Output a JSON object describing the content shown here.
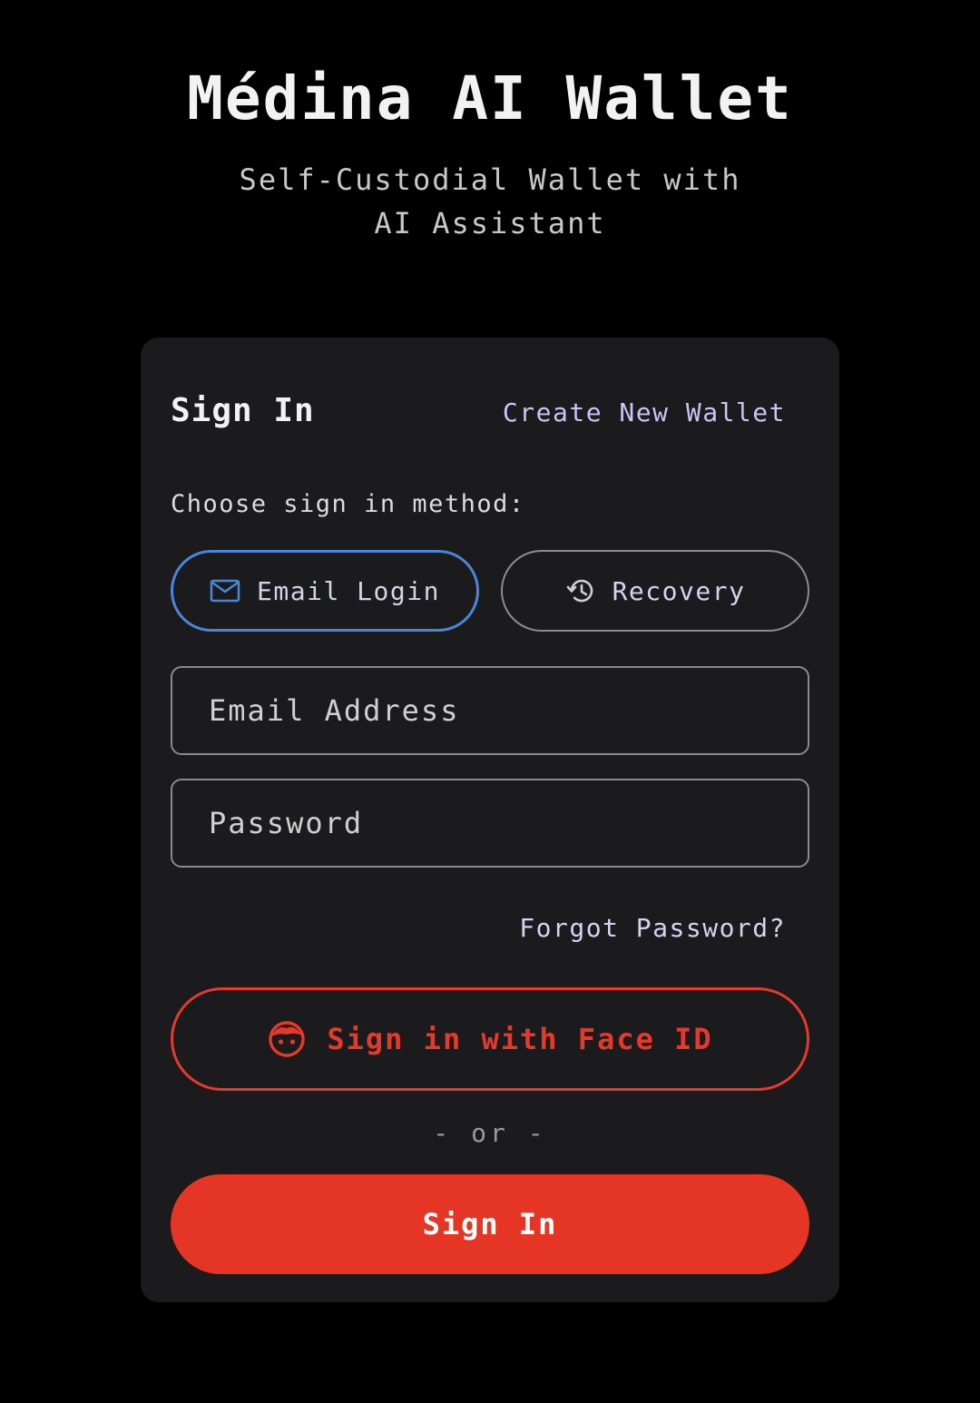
{
  "header": {
    "title": "Médina AI Wallet",
    "subtitle": "Self-Custodial Wallet with AI Assistant"
  },
  "card": {
    "title": "Sign In",
    "create_link": "Create New Wallet",
    "method_label": "Choose sign in method:",
    "methods": [
      {
        "label": "Email Login",
        "icon": "envelope-icon",
        "selected": true
      },
      {
        "label": "Recovery",
        "icon": "history-icon",
        "selected": false
      }
    ],
    "email_field": {
      "placeholder": "Email Address",
      "value": ""
    },
    "password_field": {
      "placeholder": "Password",
      "value": ""
    },
    "forgot_link": "Forgot Password?",
    "faceid_button": {
      "label": "Sign in with Face ID",
      "icon": "face-icon"
    },
    "or_divider": "- or -",
    "signin_button": "Sign In"
  },
  "colors": {
    "background": "#000000",
    "card": "#1b1b1d",
    "accent_red": "#e43525",
    "selected_outline": "#4a86d8",
    "link": "#c9c4f5"
  }
}
